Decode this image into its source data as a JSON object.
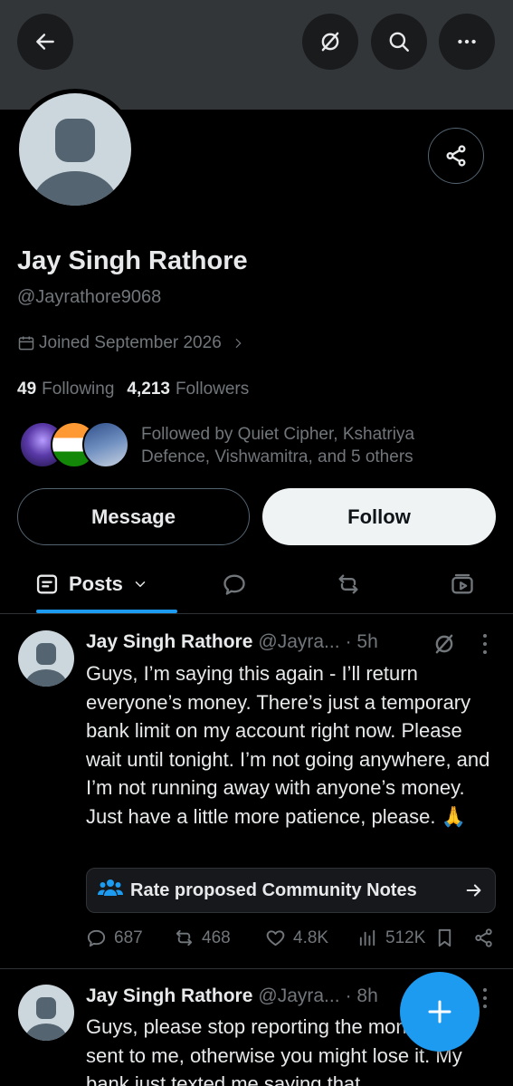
{
  "header": {
    "back_icon": "arrow-left-icon",
    "grok_icon": "grok-icon",
    "search_icon": "search-icon",
    "more_icon": "more-horizontal-icon"
  },
  "profile": {
    "name": "Jay Singh Rathore",
    "handle": "@Jayrathore9068",
    "joined": "Joined September 2026",
    "following_count": "49",
    "following_label": "Following",
    "followers_count": "4,213",
    "followers_label": "Followers",
    "followed_by": "Followed by Quiet Cipher, Kshatriya Defence, Vishwamitra, and 5 others"
  },
  "buttons": {
    "message": "Message",
    "follow": "Follow"
  },
  "tabs": {
    "posts": "Posts",
    "replies_icon": "reply-icon",
    "reposts_icon": "repost-icon",
    "media_icon": "media-icon"
  },
  "posts": [
    {
      "name": "Jay Singh Rathore",
      "handle": "@Jayra...",
      "time": "· 5h",
      "text": "Guys, I’m saying this again - I’ll return everyone’s money. There’s just a temporary bank limit on my account right now. Please wait until tonight. I’m not going anywhere, and I’m not running away with anyone’s money. Just have a little more patience, please. 🙏",
      "community_notes": "Rate proposed Community Notes",
      "replies": "687",
      "reposts": "468",
      "likes": "4.8K",
      "views": "512K"
    },
    {
      "name": "Jay Singh Rathore",
      "handle": "@Jayra...",
      "time": "· 8h",
      "text": "Guys, please stop reporting the money you sent to me, otherwise you might lose it. My bank just texted me saying that"
    }
  ],
  "colors": {
    "accent": "#1d9bf0",
    "background": "#000000",
    "banner": "#333639",
    "muted": "#71767b"
  }
}
